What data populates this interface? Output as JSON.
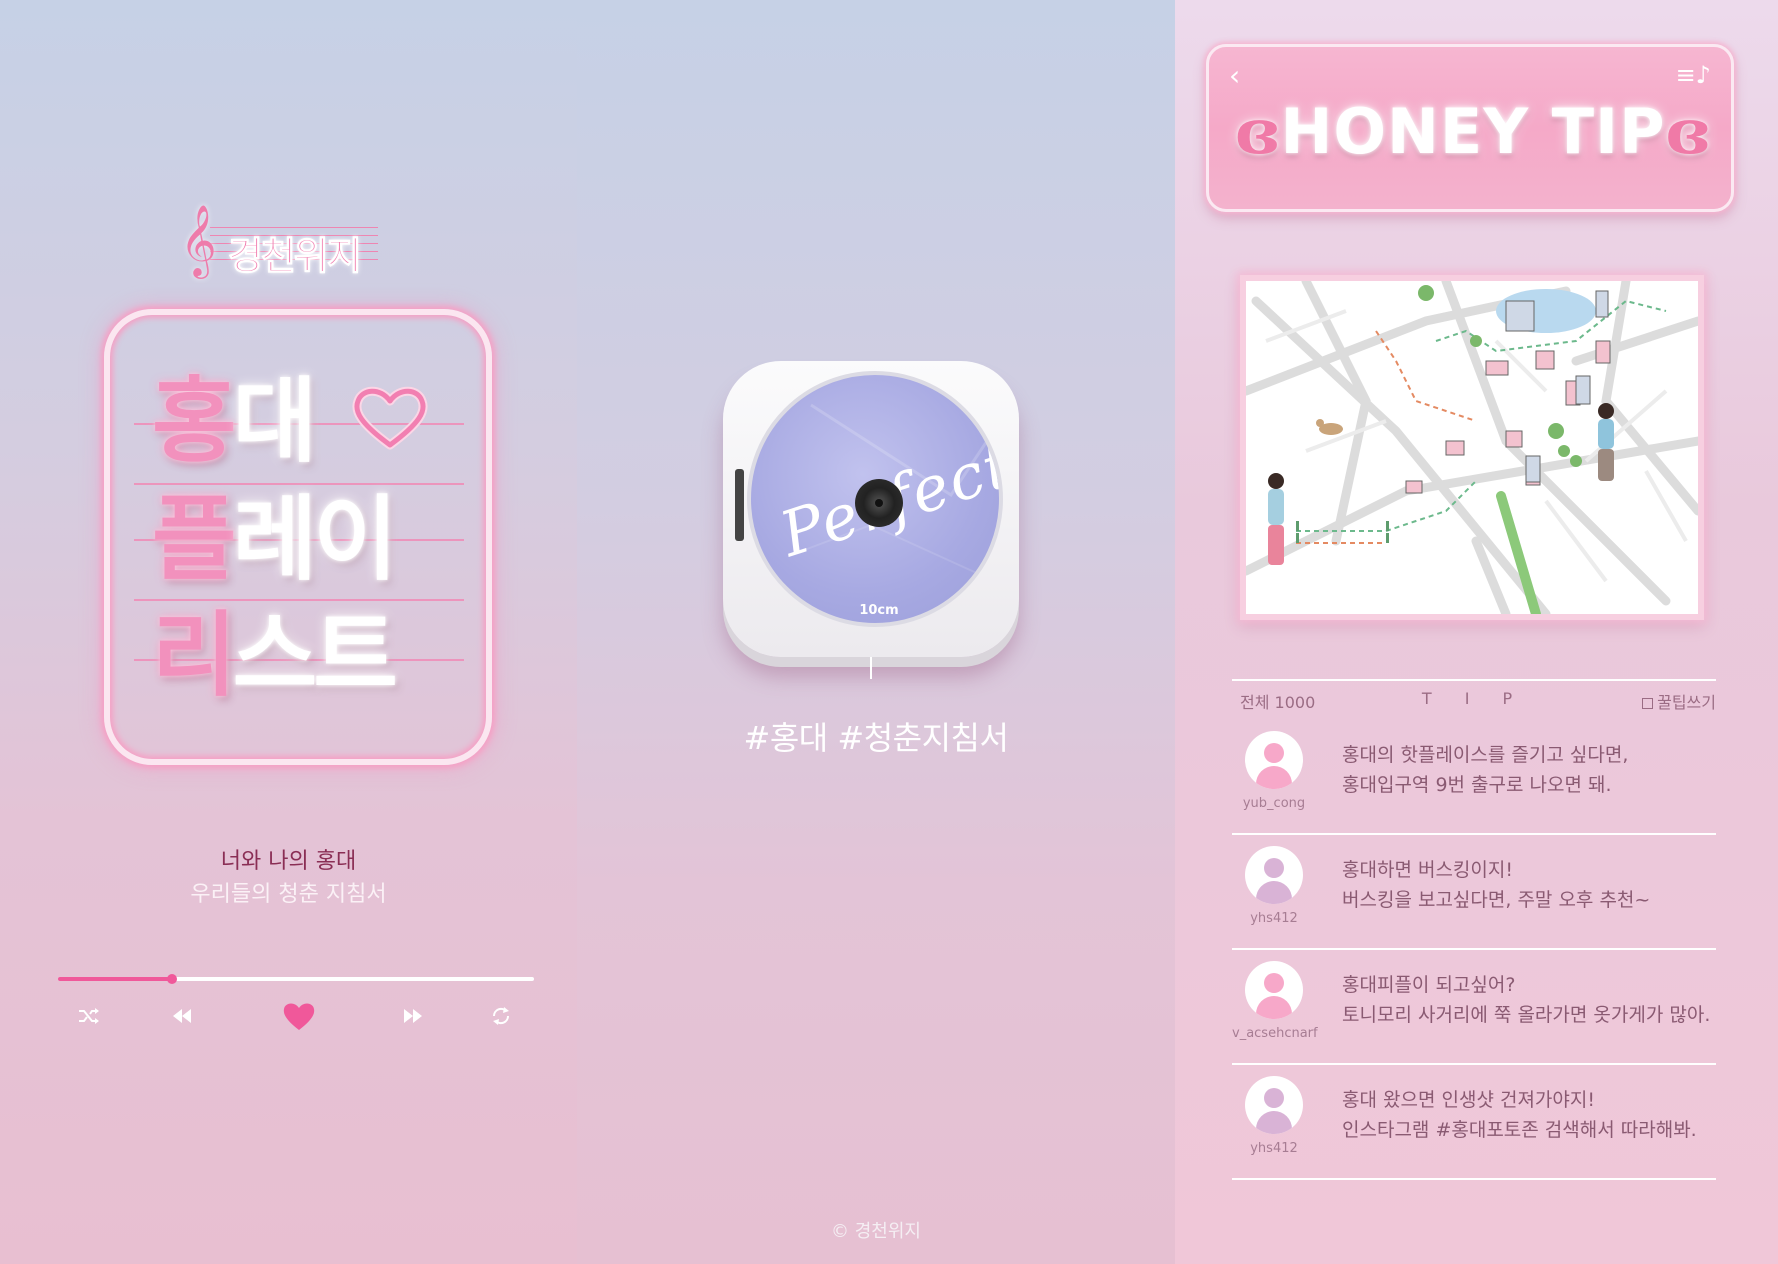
{
  "left": {
    "brand": "경천위지",
    "title": {
      "line1_pink": "홍",
      "line1_white": "대",
      "line2_pink": "플",
      "line2_white": "레이",
      "line3_pink": "리",
      "line3_white": "스트"
    },
    "subtitle_1": "너와 나의 홍대",
    "subtitle_2": "우리들의 청춘 지침서",
    "progress": 0.24,
    "controls": [
      "shuffle-icon",
      "rewind-icon",
      "heart-icon",
      "fast-forward-icon",
      "repeat-icon"
    ]
  },
  "middle": {
    "cd_script": "Perfect",
    "cd_brand": "10cm",
    "hashtags": "#홍대 #청춘지침서",
    "copyright": "© 경천위지"
  },
  "right": {
    "back_icon": "‹",
    "menu_icon": "≡♪",
    "honey_title": "HONEY TIP",
    "tip_count": "전체 1000",
    "tip_label": "T I P",
    "write_label": "꿀팁쓰기",
    "tips": [
      {
        "user": "yub_cong",
        "line1": "홍대의 핫플레이스를 즐기고 싶다면,",
        "line2": "홍대입구역 9번 출구로 나오면 돼.",
        "avatar_color": "#f7a8c9"
      },
      {
        "user": "yhs412",
        "line1": "홍대하면 버스킹이지!",
        "line2": "버스킹을 보고싶다면, 주말 오후 추천~",
        "avatar_color": "#d9b3d6"
      },
      {
        "user": "v_acsehcnarf",
        "line1": "홍대피플이 되고싶어?",
        "line2": "토니모리 사거리에 쭉 올라가면 옷가게가 많아.",
        "avatar_color": "#f7a8c9"
      },
      {
        "user": "yhs412",
        "line1": "홍대 왔으면 인생샷 건져가야지!",
        "line2": "인스타그램 #홍대포토존 검색해서 따라해봐.",
        "avatar_color": "#d9b3d6"
      }
    ]
  },
  "colors": {
    "accent_pink": "#f0589a",
    "neon_pink": "#f291bd",
    "text_plum": "#8a5a72"
  }
}
